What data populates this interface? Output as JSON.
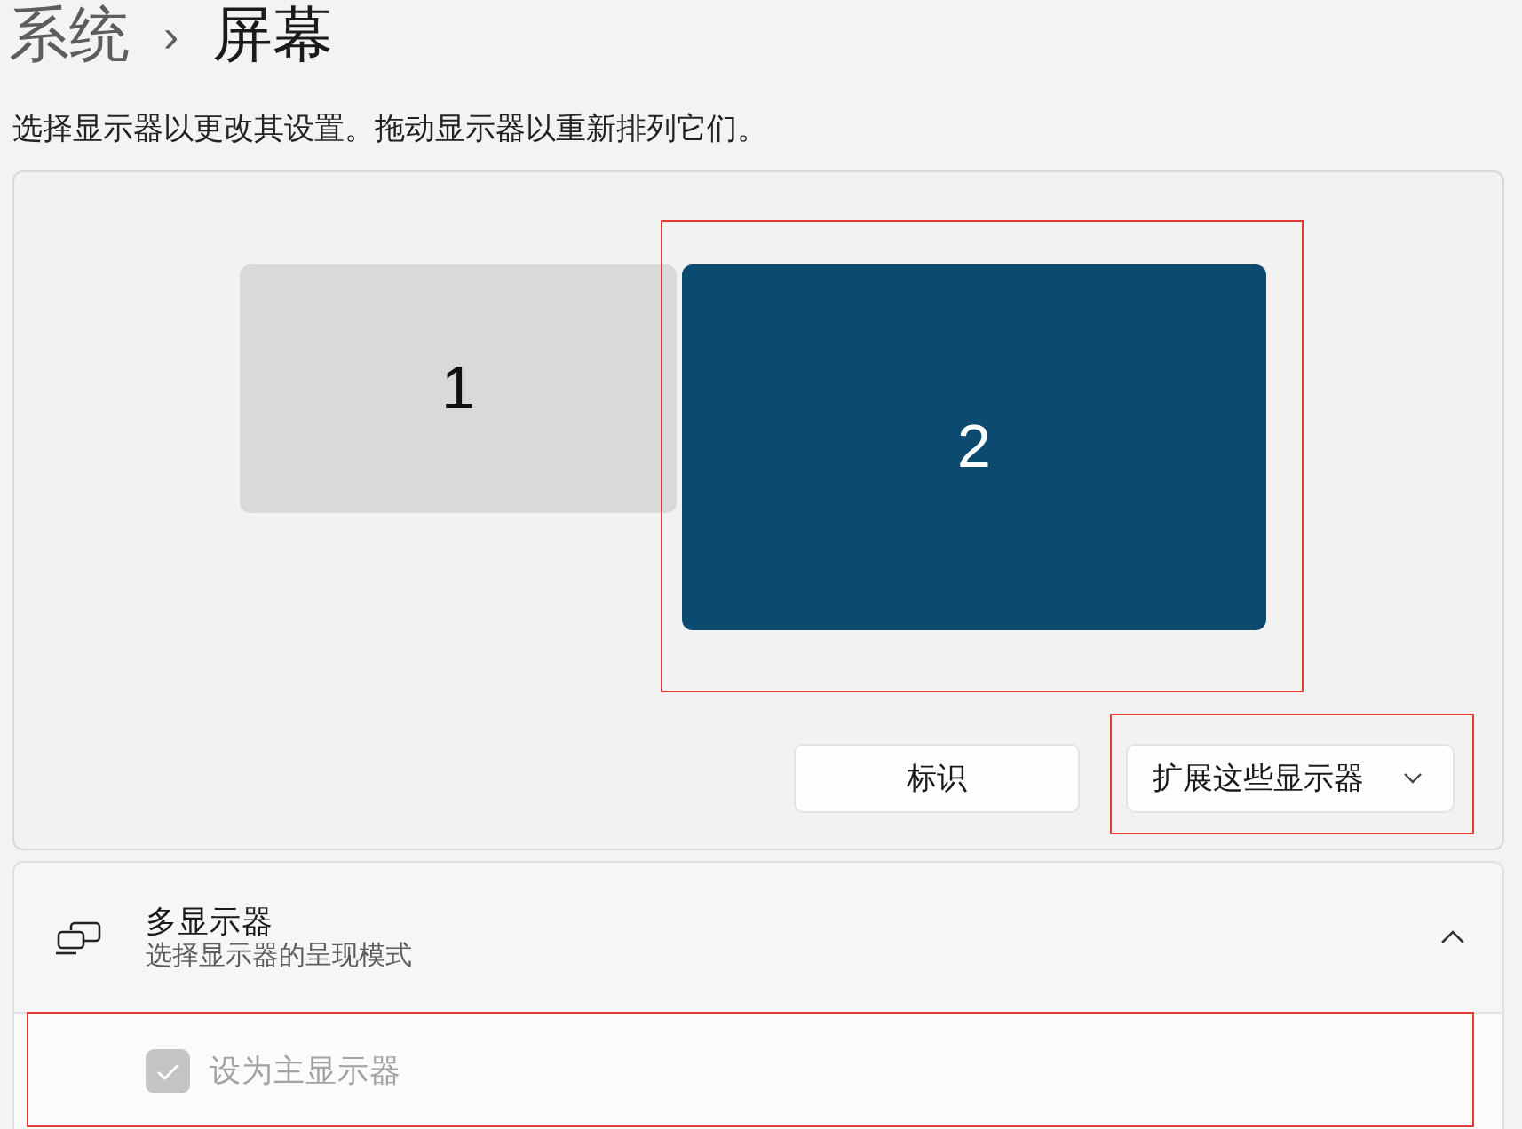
{
  "breadcrumb": {
    "parent": "系统",
    "separator": "›",
    "current": "屏幕"
  },
  "description": "选择显示器以更改其设置。拖动显示器以重新排列它们。",
  "monitors": [
    {
      "label": "1",
      "selected": false,
      "highlighted": false
    },
    {
      "label": "2",
      "selected": true,
      "highlighted": true
    }
  ],
  "identify_button": {
    "label": "标识"
  },
  "mode_dropdown": {
    "value": "扩展这些显示器",
    "highlighted": true
  },
  "multiple_displays": {
    "title": "多显示器",
    "subtitle": "选择显示器的呈现模式",
    "expanded": true,
    "options": [
      {
        "kind": "checkbox",
        "label": "设为主显示器",
        "checked": true,
        "disabled": true,
        "highlighted": true
      }
    ]
  }
}
